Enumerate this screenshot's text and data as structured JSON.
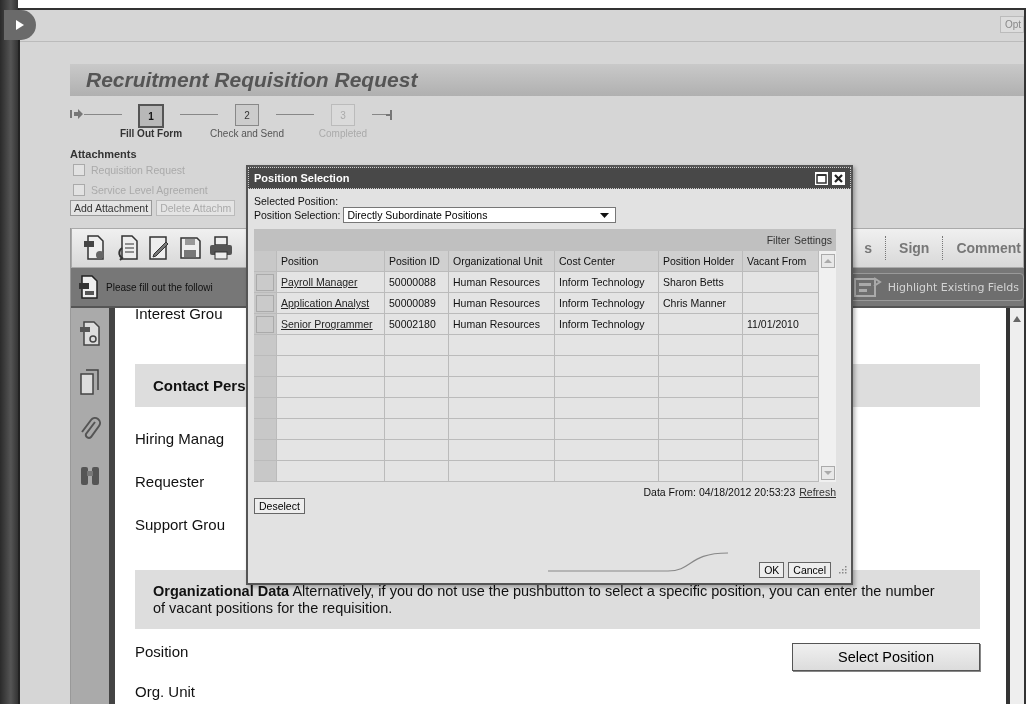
{
  "top_button": "Opt",
  "title": "Recruitment Requisition Request",
  "steps": [
    {
      "number": "1",
      "label": "Fill Out Form",
      "selected": true,
      "disabled": false
    },
    {
      "number": "2",
      "label": "Check and Send",
      "selected": false,
      "disabled": false
    },
    {
      "number": "3",
      "label": "Completed",
      "selected": false,
      "disabled": true
    }
  ],
  "attachments": {
    "heading": "Attachments",
    "items": [
      {
        "label": "Requisition Request",
        "checked": false
      },
      {
        "label": "Service Level Agreement",
        "checked": false
      }
    ],
    "buttons": [
      {
        "label": "Add Attachment",
        "disabled": false
      },
      {
        "label": "Delete Attachm",
        "disabled": true
      }
    ]
  },
  "viewer": {
    "tabs": [
      "s",
      "Sign",
      "Comment"
    ],
    "message": "Please fill out the followi",
    "highlight_button": "Highlight Existing Fields",
    "form": {
      "interest_group": "Interest Grou",
      "contact_heading": "Contact Pers",
      "contact_fields": [
        "Hiring Manag",
        "Requester",
        "Support Grou"
      ],
      "org_text": "**Organizational Data**    Alternatively, if you do not use the pushbutton to select a specific position, you can enter the number of vacant positions for the requisition.",
      "position_label": "Position",
      "select_button": "Select Position",
      "org_unit_label": "Org. Unit"
    }
  },
  "dialog": {
    "title": "Position Selection",
    "selected_position": "Selected Position:",
    "selection_label": "Position Selection:",
    "selection_value": "Directly Subordinate Positions",
    "table_actions": [
      "Filter",
      "Settings"
    ],
    "columns": [
      "Position",
      "Position ID",
      "Organizational Unit",
      "Cost Center",
      "Position Holder",
      "Vacant From"
    ],
    "rows": [
      {
        "selected": false,
        "cells": [
          "Payroll Manager",
          "50000088",
          "Human Resources",
          "Inform Technology",
          "Sharon Betts",
          null
        ]
      },
      {
        "selected": false,
        "cells": [
          "Application Analyst",
          "50000089",
          "Human Resources",
          "Inform Technology",
          "Chris Manner",
          null
        ]
      },
      {
        "selected": false,
        "cells": [
          "Senior Programmer",
          "50002180",
          "Human Resources",
          "Inform Technology",
          null,
          "11/01/2010"
        ]
      }
    ],
    "data_from": "Data From: 04/18/2012 20:53:23",
    "refresh": "Refresh",
    "deselect": "Deselect",
    "ok": "OK",
    "cancel": "Cancel"
  }
}
